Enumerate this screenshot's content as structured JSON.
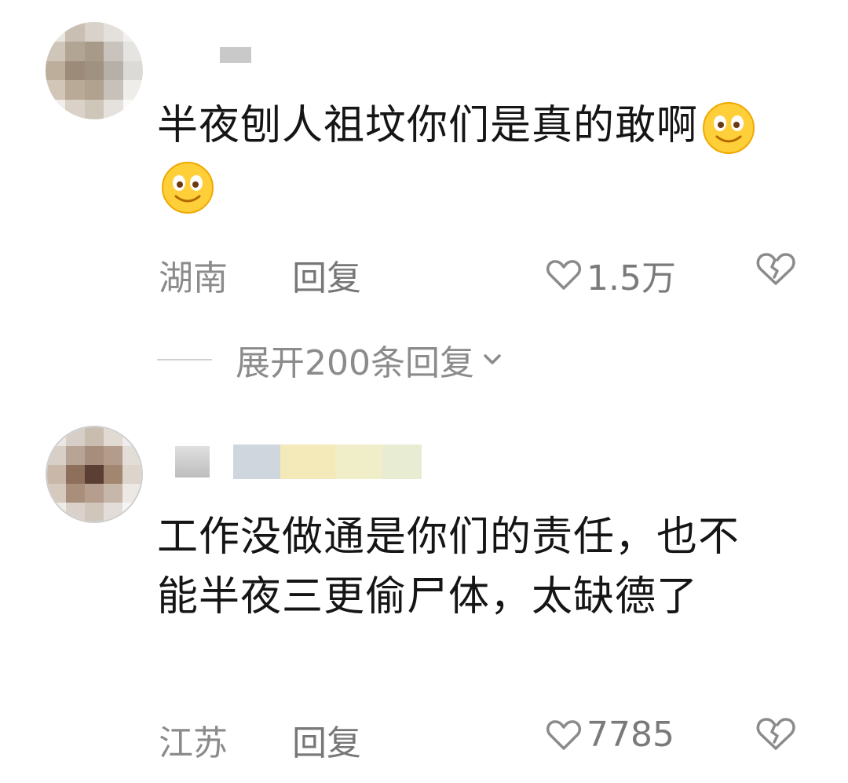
{
  "comments": [
    {
      "text": "半夜刨人祖坟你们是真的敢啊",
      "emojis": [
        "smiley-emoji",
        "smiley-emoji"
      ],
      "location": "湖南",
      "reply_label": "回复",
      "likes": "1.5万",
      "expand_replies": "展开200条回复"
    },
    {
      "text": "工作没做通是你们的责任，也不能半夜三更偷尸体，太缺德了",
      "location": "江苏",
      "reply_label": "回复",
      "likes": "7785"
    }
  ],
  "icons": {
    "like": "heart-outline-icon",
    "dislike": "broken-heart-icon",
    "expand": "chevron-down-icon"
  },
  "colors": {
    "text": "#151515",
    "meta": "#8b8b8b",
    "emoji": "#ffcf3a"
  }
}
